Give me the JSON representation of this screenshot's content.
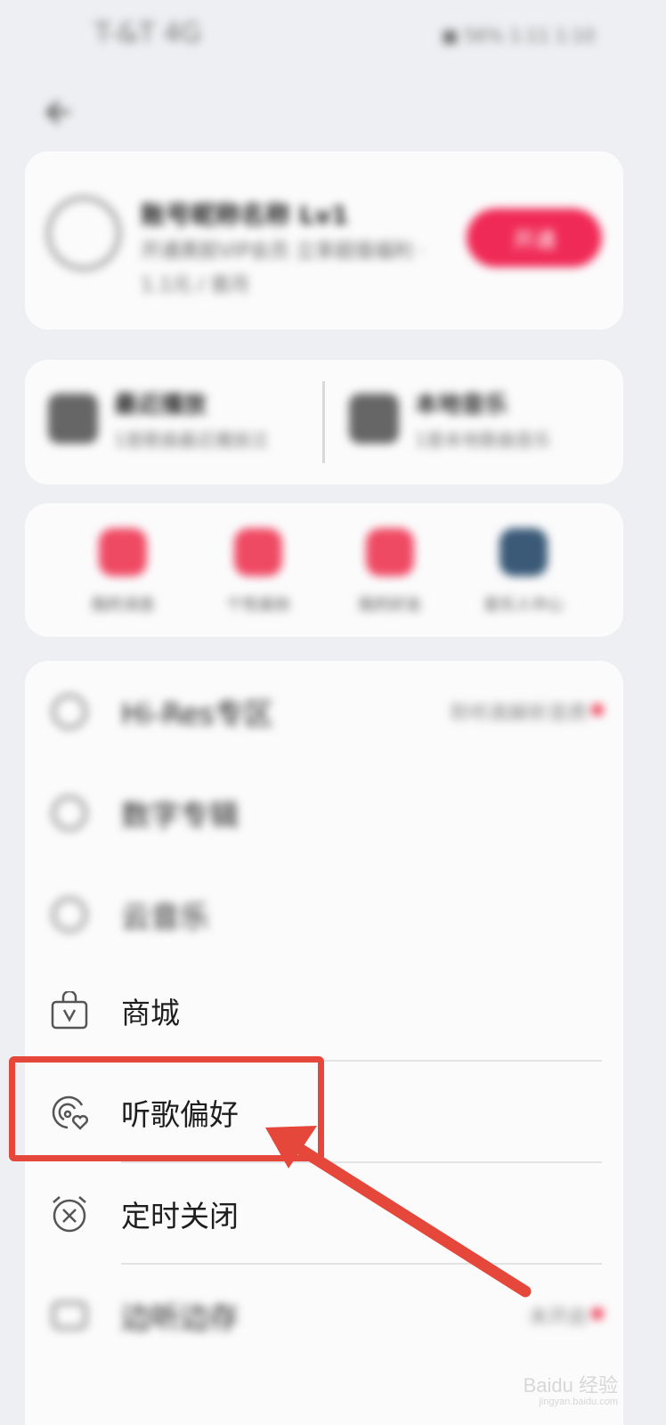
{
  "status": {
    "left": "T-&T 4G",
    "right": "■ 56% 1:11 1:10"
  },
  "profile": {
    "name": "账号昵称名称 Lv1",
    "subtitle": "开通黑胶VIP会员 立享超值福利 · 1.1元 / 首月",
    "button": "开通",
    "accent": "#f02a56"
  },
  "stats": [
    {
      "title": "最近播放",
      "subtitle": "1首歌曲最近播放过"
    },
    {
      "title": "本地音乐",
      "subtitle": "1首本地歌曲音乐"
    }
  ],
  "quick": [
    {
      "label": "我的消息",
      "icon": "message-icon",
      "color": "#ef4a64"
    },
    {
      "label": "个性装扮",
      "icon": "tshirt-icon",
      "color": "#ef4a64"
    },
    {
      "label": "我的好友",
      "icon": "friends-icon",
      "color": "#ef4a64"
    },
    {
      "label": "音乐人中心",
      "icon": "musician-icon",
      "color": "#3a5a78"
    }
  ],
  "menu": [
    {
      "label": "Hi-Res专区",
      "right": "聆听高解析音质",
      "icon": "hires-icon",
      "blurred": true,
      "dot": true
    },
    {
      "label": "数字专辑",
      "right": "",
      "icon": "album-icon",
      "blurred": true,
      "dot": false
    },
    {
      "label": "云音乐",
      "right": "",
      "icon": "cloud-icon",
      "blurred": true,
      "dot": false
    },
    {
      "label": "商城",
      "right": "",
      "icon": "shopping-bag-icon",
      "blurred": false,
      "dot": false
    },
    {
      "label": "听歌偏好",
      "right": "",
      "icon": "music-preference-icon",
      "blurred": false,
      "dot": false
    },
    {
      "label": "定时关闭",
      "right": "",
      "icon": "alarm-close-icon",
      "blurred": false,
      "dot": false
    },
    {
      "label": "边听边存",
      "right": "未开启",
      "icon": "download-icon",
      "blurred": true,
      "dot": true
    }
  ],
  "watermark": {
    "brand": "Baidu 经验",
    "url": "jingyan.baidu.com"
  },
  "annotation": {
    "color": "#e5483a"
  }
}
